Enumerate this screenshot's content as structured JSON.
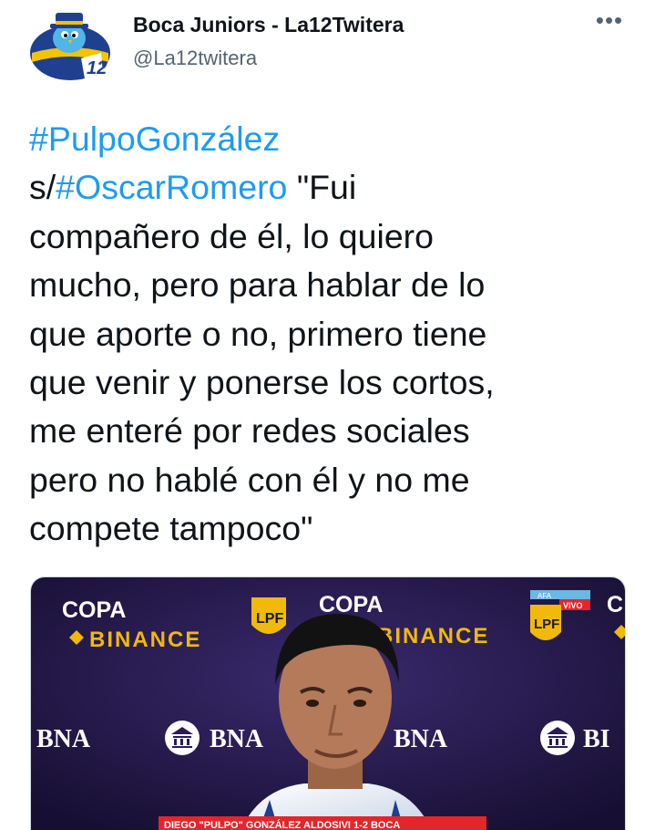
{
  "tweet": {
    "display_name": "Boca Juniors - La12Twitera",
    "handle": "@La12twitera",
    "more_icon": "more-horizontal-icon",
    "more_label": "•••",
    "text_lines": [
      {
        "parts": [
          {
            "text": "#PulpoGonzález",
            "tag": true
          }
        ]
      },
      {
        "parts": [
          {
            "text": "s/",
            "tag": false
          },
          {
            "text": "#OscarRomero",
            "tag": true
          },
          {
            "text": " \"Fui",
            "tag": false
          }
        ]
      },
      {
        "parts": [
          {
            "text": "compañero de él, lo quiero",
            "tag": false
          }
        ]
      },
      {
        "parts": [
          {
            "text": "mucho, pero para hablar de lo",
            "tag": false
          }
        ]
      },
      {
        "parts": [
          {
            "text": "que aporte o no, primero tiene",
            "tag": false
          }
        ]
      },
      {
        "parts": [
          {
            "text": "que venir y ponerse los cortos,",
            "tag": false
          }
        ]
      },
      {
        "parts": [
          {
            "text": "me enteré por redes sociales",
            "tag": false
          }
        ]
      },
      {
        "parts": [
          {
            "text": "pero no hablé con él y no me",
            "tag": false
          }
        ]
      },
      {
        "parts": [
          {
            "text": "compete tampoco\"",
            "tag": false
          }
        ]
      }
    ]
  },
  "avatar": {
    "badge_text": "12",
    "colors": {
      "blue": "#1f3f8f",
      "gold": "#f3c400",
      "bird": "#4fb6e8"
    }
  },
  "media": {
    "banner": {
      "copa_label": "COPA",
      "binance_label": "BINANCE",
      "lpf_label": "LPF",
      "afa_label": "AFA",
      "vivo_label": "VIVO",
      "bna_label": "BNA"
    },
    "lower_third": "DIEGO \"PULPO\" GONZÁLEZ   ALDOSIVI 1-2 BOCA",
    "colors": {
      "backdrop": "#2a1d52",
      "backdrop_dark": "#170f33",
      "gold": "#f0b90b",
      "red": "#e3262b",
      "skin": "#b47a5a"
    }
  }
}
